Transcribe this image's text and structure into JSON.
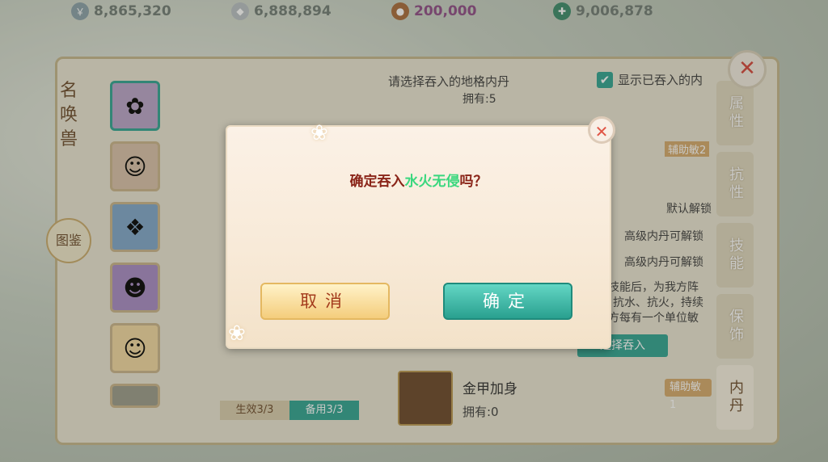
{
  "currencies": [
    {
      "icon": "coin-bag-icon",
      "value": "8,865,320",
      "color": "#7a7a7a"
    },
    {
      "icon": "silver-ingot-icon",
      "value": "6,888,894",
      "color": "#7a7a7a"
    },
    {
      "icon": "copper-coin-icon",
      "value": "200,000",
      "color": "#8a3a7a"
    },
    {
      "icon": "jade-coin-icon",
      "value": "9,006,878",
      "color": "#7a7a7a"
    }
  ],
  "panel": {
    "title": "名唤兽",
    "handbook": "图鉴",
    "pet_tabs": {
      "active": "生效3/3",
      "backup": "备用3/3"
    },
    "prompt": "请选择吞入的地格内丹",
    "show_devoured": "显示已吞入的内",
    "side_tabs": [
      "属性",
      "抗性",
      "技能",
      "保饰",
      "内丹"
    ],
    "item": {
      "name": "金甲加身",
      "count": "拥有:0",
      "tag": "辅助敏1"
    },
    "misc": {
      "top_count": "拥有:5",
      "assist_tag": "辅助敏2",
      "default_unlock": "默认解锁",
      "advanced_unlock_1": "高级内丹可解锁",
      "advanced_unlock_2": "高级内丹可解锁",
      "desc_1": "技能后，为我方阵",
      "desc_2": "抗水、抗火，持续",
      "desc_3": "方每有一个单位敏",
      "select_devour": "选择吞入"
    }
  },
  "modal": {
    "message_prefix": "确定吞入",
    "highlight": "水火无侵",
    "message_suffix": "吗？",
    "cancel": "取消",
    "confirm": "确定"
  },
  "colors": {
    "accent": "#2fa291",
    "warn": "#8a2418",
    "highlight": "#3ad77e"
  }
}
